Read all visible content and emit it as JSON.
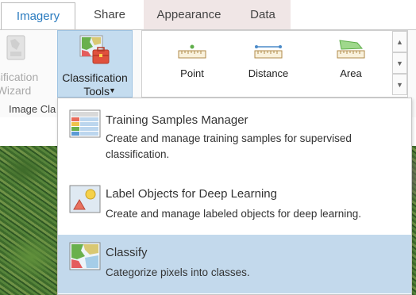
{
  "tabs": [
    {
      "label": "Imagery"
    },
    {
      "label": "Share"
    },
    {
      "label": "Appearance"
    },
    {
      "label": "Data"
    }
  ],
  "ribbon": {
    "wizard_button": {
      "line1": "ssification",
      "line2": "Wizard"
    },
    "classification_tools": {
      "line1": "Classification",
      "line2": "Tools"
    },
    "group_label": "Image Cla",
    "gallery": [
      {
        "label": "Point"
      },
      {
        "label": "Distance"
      },
      {
        "label": "Area"
      }
    ]
  },
  "menu": {
    "items": [
      {
        "title": "Training Samples Manager",
        "desc_line1": "Create and manage training samples for supervised",
        "desc_line2": "classification."
      },
      {
        "title": "Label Objects for Deep Learning",
        "desc_line1": "Create and manage labeled objects for deep learning."
      },
      {
        "title": "Classify",
        "desc_line1": "Categorize pixels into classes."
      }
    ]
  },
  "colors": {
    "active_tab_text": "#2a7bbf",
    "contextual_tab_bg": "#f0e6e6",
    "ribbon_selected_bg": "#c4dcef",
    "menu_selected_bg": "#c3d9ec"
  }
}
